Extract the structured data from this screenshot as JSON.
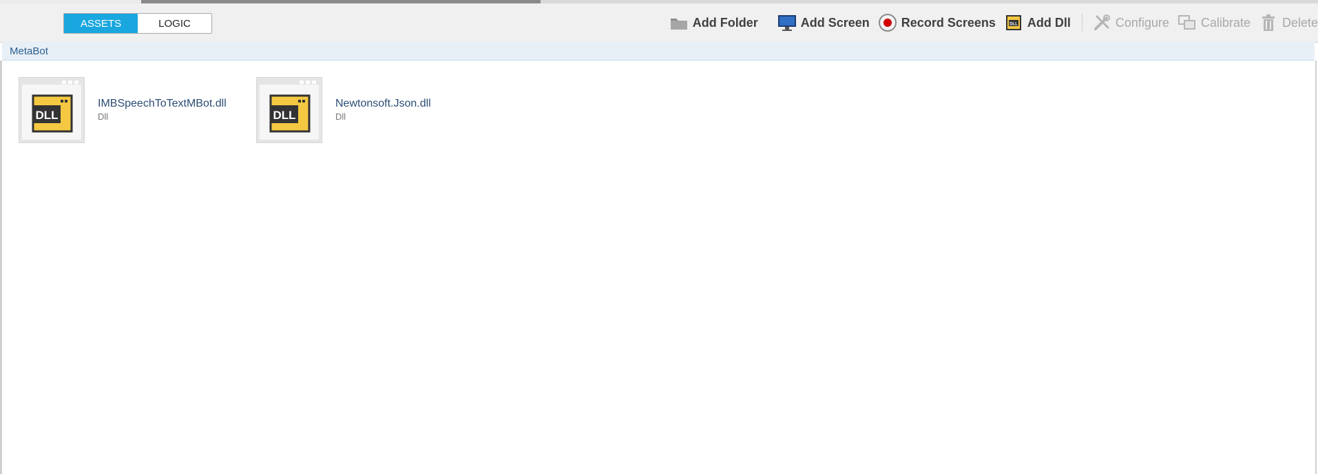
{
  "toolbar": {
    "toggle": {
      "assets": "ASSETS",
      "logic": "LOGIC"
    },
    "add_folder": "Add Folder",
    "add_screen": "Add Screen",
    "record_screens": "Record Screens",
    "add_dll": "Add Dll",
    "configure": "Configure",
    "calibrate": "Calibrate",
    "delete": "Delete"
  },
  "breadcrumb": "MetaBot",
  "files": [
    {
      "name": "IMBSpeechToTextMBot.dll",
      "type": "Dll",
      "icon": "dll-file-icon"
    },
    {
      "name": "Newtonsoft.Json.dll",
      "type": "Dll",
      "icon": "dll-file-icon"
    }
  ],
  "colors": {
    "accent": "#1aa7e0",
    "link": "#2b4c73",
    "dll_yellow": "#f5c842"
  }
}
